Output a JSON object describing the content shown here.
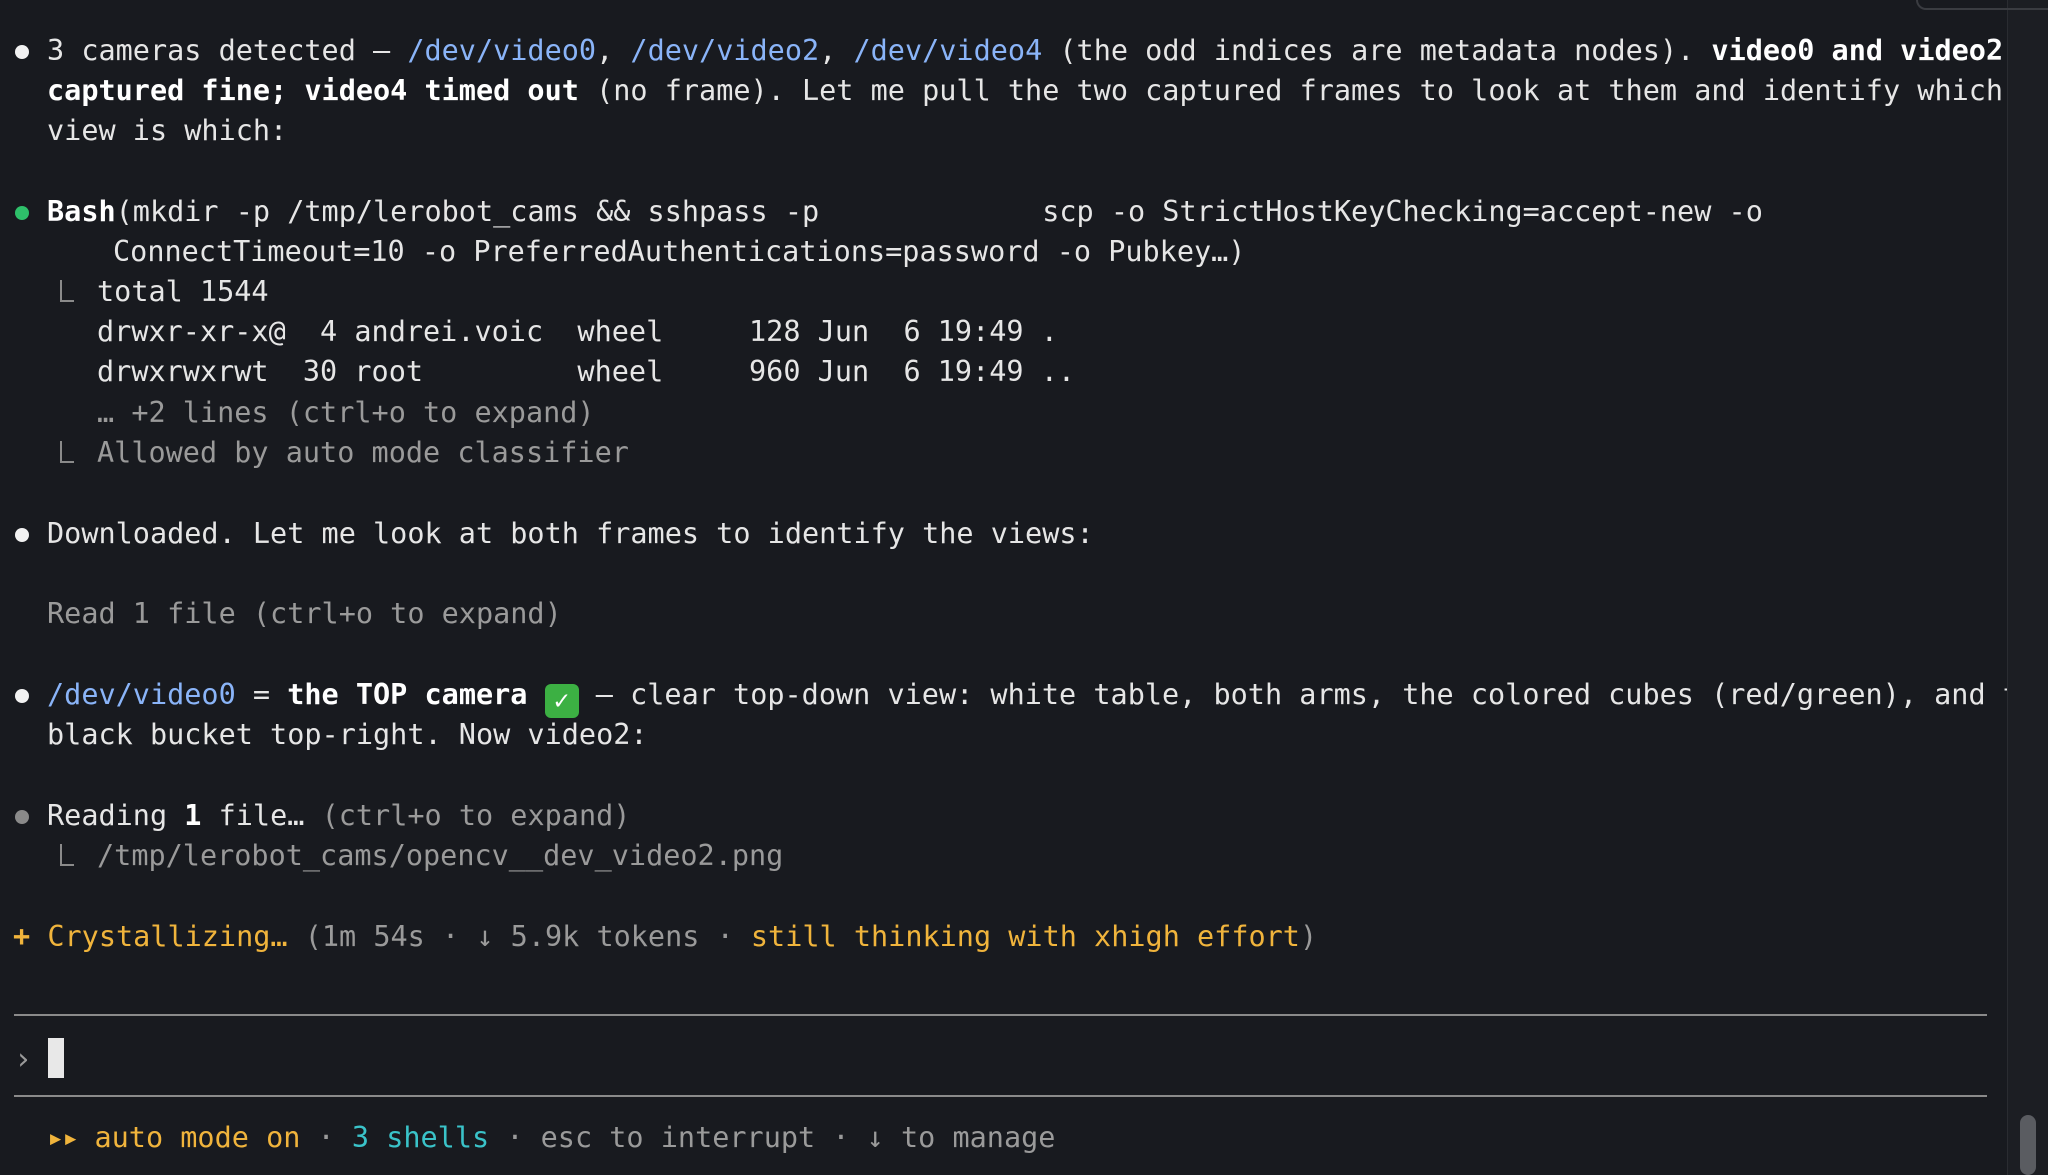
{
  "msg1": {
    "l1_a": "3 cameras detected – ",
    "dev0": "/dev/video0",
    "sep1": ", ",
    "dev2": "/dev/video2",
    "sep2": ", ",
    "dev4": "/dev/video4",
    "l1_b": " (the odd indices are metadata nodes). ",
    "l1_bold": "video0 and video2",
    "l2_bold": "captured fine; video4 timed out",
    "l2_rest": " (no frame). Let me pull the two captured frames to look at them and identify which",
    "l3": "view is which:"
  },
  "bash": {
    "tool": "Bash",
    "cmd1": "(mkdir -p /tmp/lerobot_cams && sshpass -p             scp -o StrictHostKeyChecking=accept-new -o",
    "cmd2": "ConnectTimeout=10 -o PreferredAuthentications=password -o Pubkey…)",
    "out1": "total 1544",
    "out2": "drwxr-xr-x@  4 andrei.voic  wheel     128 Jun  6 19:49 .",
    "out3": "drwxrwxrwt  30 root         wheel     960 Jun  6 19:49 ..",
    "out4": "… +2 lines (ctrl+o to expand)",
    "out5": "Allowed by auto mode classifier"
  },
  "msg2": "Downloaded. Let me look at both frames to identify the views:",
  "read1": "Read 1 file (ctrl+o to expand)",
  "msg3": {
    "dev0": "/dev/video0",
    "eq": " = ",
    "bold": "the TOP camera",
    "check": "✓",
    "rest": " – clear top-down view: white table, both arms, the colored cubes (red/green), and the",
    "l2": "black bucket top-right. Now video2:"
  },
  "reading": {
    "a": "Reading ",
    "num": "1",
    "b": " file… ",
    "c": "(ctrl+o to expand)",
    "path": "/tmp/lerobot_cams/opencv__dev_video2.png"
  },
  "status": {
    "star": "+",
    "verb": "Crystallizing…",
    "paren_open": " (",
    "time": "1m 54s",
    "dot1": " · ",
    "arrow": "↓",
    "tokens": " 5.9k tokens",
    "dot2": " · ",
    "thinking": "still thinking with xhigh effort",
    "paren_close": ")"
  },
  "prompt": {
    "caret": "›"
  },
  "footer": {
    "arrows": "▸▸",
    "auto": " auto mode on",
    "dot1": " · ",
    "shells": "3 shells",
    "dot2": " · ",
    "esc": "esc to interrupt",
    "dot3": " · ",
    "manage": "↓ to manage"
  },
  "colors": {
    "background": "#181a1f",
    "link": "#8ab4f8",
    "amber": "#f0b43c",
    "cyan": "#3ac3c9",
    "green": "#2ec06a"
  }
}
